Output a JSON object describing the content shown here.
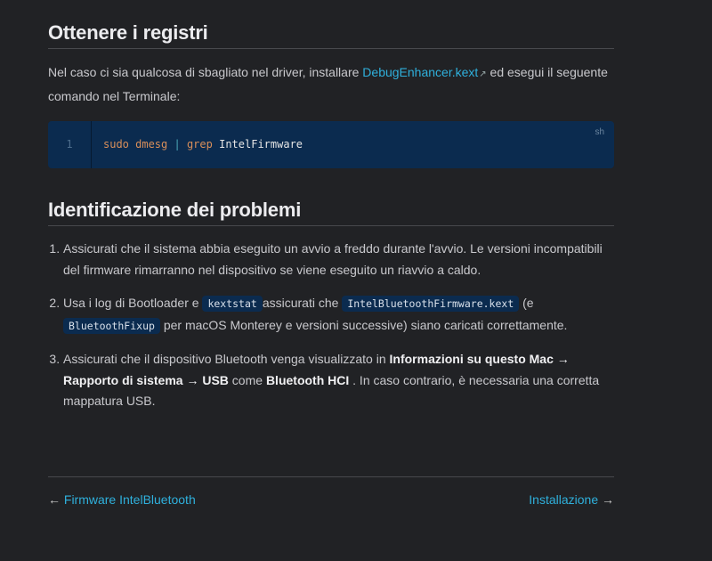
{
  "section1": {
    "title": "Ottenere i registri",
    "text_before": "Nel caso ci sia qualcosa di sbagliato nel driver, installare ",
    "link": "DebugEnhancer.kext",
    "text_after": " ed esegui il seguente comando nel Terminale:"
  },
  "code": {
    "line_number": "1",
    "cmd1": "sudo dmesg",
    "pipe": "|",
    "cmd2": "grep",
    "arg": "IntelFirmware",
    "lang": "sh"
  },
  "section2": {
    "title": "Identificazione dei problemi",
    "item1": "Assicurati che il sistema abbia eseguito un avvio a freddo durante l'avvio. Le versioni incompatibili del firmware rimarranno nel dispositivo se viene eseguito un riavvio a caldo.",
    "item2": {
      "t1": "Usa i log di Bootloader e ",
      "c1": "kextstat",
      "t2": "assicurati che ",
      "c2": "IntelBluetoothFirmware.kext",
      "t3": " (e ",
      "c3": "BluetoothFixup",
      "t4": " per macOS Monterey e versioni successive) siano caricati correttamente."
    },
    "item3": {
      "t1": "Assicurati che il dispositivo Bluetooth venga visualizzato in ",
      "b1": "Informazioni su questo Mac → Rapporto di sistema → USB",
      "t2": " come ",
      "b2": "Bluetooth HCI",
      "t3": " . In caso contrario, è necessaria una corretta mappatura USB."
    }
  },
  "footer": {
    "prev": "Firmware IntelBluetooth",
    "next": "Installazione",
    "prev_arrow": "←",
    "next_arrow": "→"
  }
}
